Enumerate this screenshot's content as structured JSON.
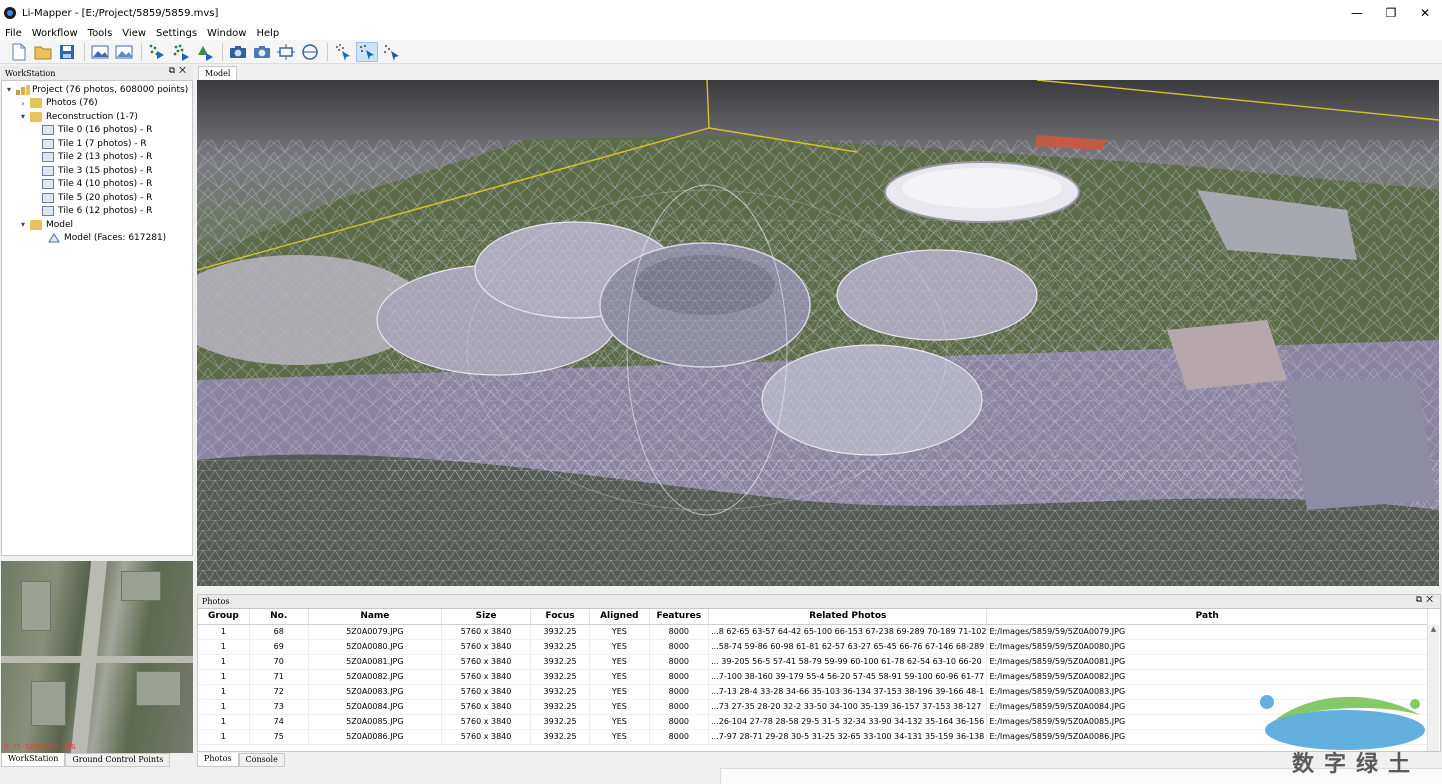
{
  "window": {
    "title": "Li-Mapper - [E:/Project/5859/5859.mvs]",
    "minimize": "—",
    "maximize": "❐",
    "close": "✕"
  },
  "menu": [
    "File",
    "Workflow",
    "Tools",
    "View",
    "Settings",
    "Window",
    "Help"
  ],
  "workstation": {
    "header": "WorkStation",
    "tree": [
      {
        "label": "Project (76 photos, 608000 points)",
        "level": 0,
        "arrow": "▾",
        "icon": "project-icon"
      },
      {
        "label": "Photos (76)",
        "level": 1,
        "arrow": "›",
        "icon": "folder-icon"
      },
      {
        "label": "Reconstruction (1-7)",
        "level": 1,
        "arrow": "▾",
        "icon": "folder-icon"
      },
      {
        "label": "Tile 0 (16 photos) - R",
        "level": 2,
        "arrow": "",
        "icon": "tile-icon"
      },
      {
        "label": "Tile 1 (7 photos) - R",
        "level": 2,
        "arrow": "",
        "icon": "tile-icon"
      },
      {
        "label": "Tile 2 (13 photos) - R",
        "level": 2,
        "arrow": "",
        "icon": "tile-icon"
      },
      {
        "label": "Tile 3 (15 photos) - R",
        "level": 2,
        "arrow": "",
        "icon": "tile-icon"
      },
      {
        "label": "Tile 4 (10 photos) - R",
        "level": 2,
        "arrow": "",
        "icon": "tile-icon"
      },
      {
        "label": "Tile 5 (20 photos) - R",
        "level": 2,
        "arrow": "",
        "icon": "tile-icon"
      },
      {
        "label": "Tile 6 (12 photos) - R",
        "level": 2,
        "arrow": "",
        "icon": "tile-icon"
      },
      {
        "label": "Model",
        "level": 1,
        "arrow": "▾",
        "icon": "folder-icon"
      },
      {
        "label": "Model (Faces: 617281)",
        "level": 2,
        "arrow": "",
        "icon": "mesh-icon"
      }
    ]
  },
  "preview": {
    "caption": "0-75-5Z0A0086.JPG"
  },
  "left_tabs": [
    "WorkStation",
    "Ground Control Points"
  ],
  "view": {
    "tab": "Model"
  },
  "photos": {
    "header": "Photos",
    "columns": [
      "Group",
      "No.",
      "Name",
      "Size",
      "Focus",
      "Aligned",
      "Features",
      "Related Photos",
      "Path"
    ],
    "rows": [
      [
        "1",
        "68",
        "5Z0A0079.JPG",
        "5760 x 3840",
        "3932.25",
        "YES",
        "8000",
        "...8 62-65 63-57 64-42 65-100 66-153 67-238 69-289 70-189 71-102",
        "E:/Images/5859/59/5Z0A0079.JPG"
      ],
      [
        "1",
        "69",
        "5Z0A0080.JPG",
        "5760 x 3840",
        "3932.25",
        "YES",
        "8000",
        "...58-74 59-86 60-98 61-81 62-57 63-27 65-45 66-76 67-146 68-289",
        "E:/Images/5859/59/5Z0A0080.JPG"
      ],
      [
        "1",
        "70",
        "5Z0A0081.JPG",
        "5760 x 3840",
        "3932.25",
        "YES",
        "8000",
        "... 39-205 56-5 57-41 58-79 59-99 60-100 61-78 62-54 63-10 66-20",
        "E:/Images/5859/59/5Z0A0081.JPG"
      ],
      [
        "1",
        "71",
        "5Z0A0082.JPG",
        "5760 x 3840",
        "3932.25",
        "YES",
        "8000",
        "...7-100 38-160 39-179 55-4 56-20 57-45 58-91 59-100 60-96 61-77",
        "E:/Images/5859/59/5Z0A0082.JPG"
      ],
      [
        "1",
        "72",
        "5Z0A0083.JPG",
        "5760 x 3840",
        "3932.25",
        "YES",
        "8000",
        "...7-13 28-4 33-28 34-66 35-103 36-134 37-153 38-196 39-166 48-1",
        "E:/Images/5859/59/5Z0A0083.JPG"
      ],
      [
        "1",
        "73",
        "5Z0A0084.JPG",
        "5760 x 3840",
        "3932.25",
        "YES",
        "8000",
        "...73 27-35 28-20 32-2 33-50 34-100 35-139 36-157 37-153 38-127",
        "E:/Images/5859/59/5Z0A0084.JPG"
      ],
      [
        "1",
        "74",
        "5Z0A0085.JPG",
        "5760 x 3840",
        "3932.25",
        "YES",
        "8000",
        "...26-104 27-78 28-58 29-5 31-5 32-34 33-90 34-132 35-164 36-156",
        "E:/Images/5859/59/5Z0A0085.JPG"
      ],
      [
        "1",
        "75",
        "5Z0A0086.JPG",
        "5760 x 3840",
        "3932.25",
        "YES",
        "8000",
        "...7-97 28-71 29-28 30-5 31-25 32-65 33-100 34-131 35-159 36-138",
        "E:/Images/5859/59/5Z0A0086.JPG"
      ]
    ]
  },
  "bottom_tabs": [
    "Photos",
    "Console"
  ],
  "watermark": "数字绿土",
  "colors": {
    "selection": "#cde4f7",
    "bbox": "#d8c12a",
    "folder": "#e8c25a",
    "accent": "#3b8ee0"
  }
}
